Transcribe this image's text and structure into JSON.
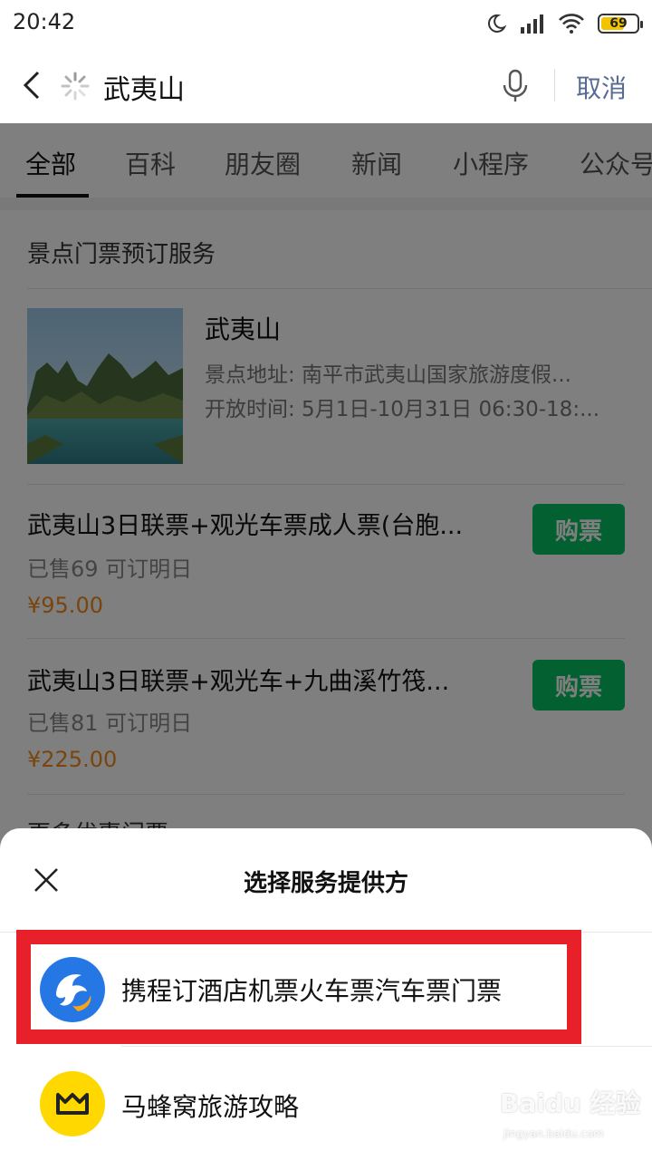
{
  "status_bar": {
    "time": "20:42",
    "battery": "69",
    "battery_level": 0.69,
    "icons": [
      "moon-icon",
      "signal-icon",
      "wifi-icon",
      "battery-icon"
    ]
  },
  "search": {
    "query": "武夷山",
    "cancel_label": "取消"
  },
  "tabs": [
    {
      "label": "全部",
      "active": true
    },
    {
      "label": "百科"
    },
    {
      "label": "朋友圈"
    },
    {
      "label": "新闻"
    },
    {
      "label": "小程序"
    },
    {
      "label": "公众号"
    }
  ],
  "results": {
    "section_title": "景点门票预订服务",
    "scenic": {
      "name": "武夷山",
      "address": "景点地址: 南平市武夷山国家旅游度假...",
      "hours": "开放时间: 5月1日-10月31日 06:30-18:..."
    },
    "tickets": [
      {
        "title": "武夷山3日联票+观光车票成人票(台胞...",
        "sold": "已售69 可订明日",
        "price": "¥95.00",
        "button": "购票"
      },
      {
        "title": "武夷山3日联票+观光车+九曲溪竹筏...",
        "sold": "已售81 可订明日",
        "price": "¥225.00",
        "button": "购票"
      }
    ],
    "more": "更多优惠门票"
  },
  "sheet": {
    "title": "选择服务提供方",
    "providers": [
      {
        "name": "携程订酒店机票火车票汽车票门票",
        "icon": "ctrip-dolphin-icon",
        "color": "#2577e3"
      },
      {
        "name": "马蜂窝旅游攻略",
        "icon": "mafengwo-icon",
        "color": "#ffd800"
      }
    ]
  },
  "watermark": {
    "brand": "Baidu 经验",
    "url": "jingyan.baidu.com"
  },
  "colors": {
    "accent_green": "#07c160",
    "price_orange": "#f28b1a",
    "link_blue": "#576b95",
    "highlight_red": "#e8202a"
  }
}
